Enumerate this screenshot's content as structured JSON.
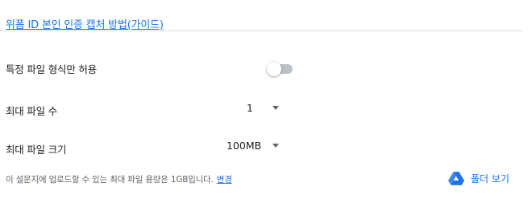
{
  "guide_link": "위폼 ID 본인 인증 캡처 방법(가이드)",
  "settings": {
    "file_type_label": "특정 파일 형식만 허용",
    "file_type_enabled": false,
    "max_files_label": "최대 파일 수",
    "max_files_value": "1",
    "max_size_label": "최대 파일 크기",
    "max_size_value": "100MB"
  },
  "footer": {
    "quota_text": "이 설문지에 업로드할 수 있는 최대 파일 용량은 1GB입니다.",
    "change_link": "변경",
    "folder_button": "폴더 보기",
    "drive_icon": "google-drive-icon"
  },
  "colors": {
    "link": "#1a73e8",
    "toggle_track": "#bdc1c6",
    "divider": "#dadce0"
  }
}
